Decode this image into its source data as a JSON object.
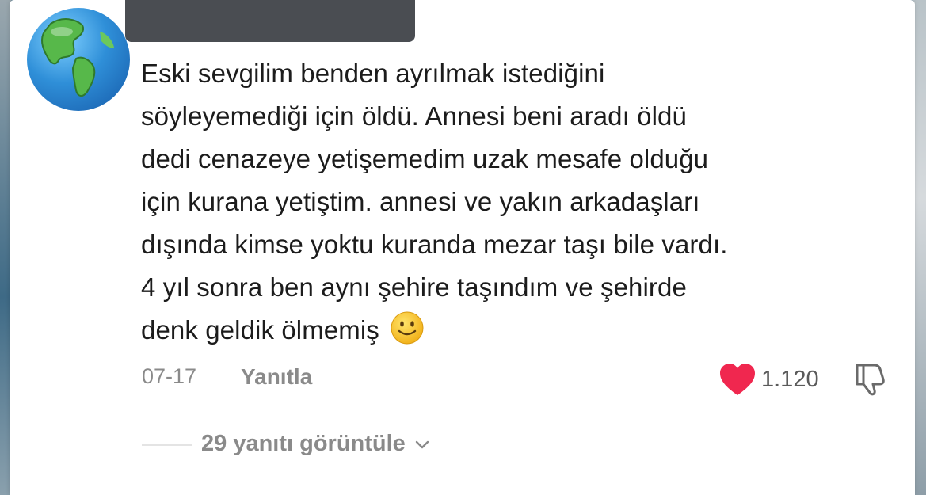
{
  "comment": {
    "lines": [
      "Eski sevgilim benden ayrılmak istediğini",
      "söyleyemediği için öldü. Annesi beni aradı öldü",
      "dedi cenazeye yetişemedim uzak mesafe olduğu",
      "için kurana yetiştim. annesi ve yakın arkadaşları",
      "dışında kimse yoktu kuranda mezar taşı bile vardı.",
      "4 yıl sonra ben aynı şehire taşındım ve şehirde",
      "denk geldik ölmemiş"
    ],
    "emoji": "slightly-smiling-face"
  },
  "meta": {
    "date": "07-17",
    "reply_label": "Yanıtla",
    "like_count": "1.120"
  },
  "replies": {
    "view_label": "29 yanıtı görüntüle"
  },
  "colors": {
    "heart": "#f0274f",
    "meta_text": "#8a8a8a",
    "redaction": "#4a4d52"
  }
}
